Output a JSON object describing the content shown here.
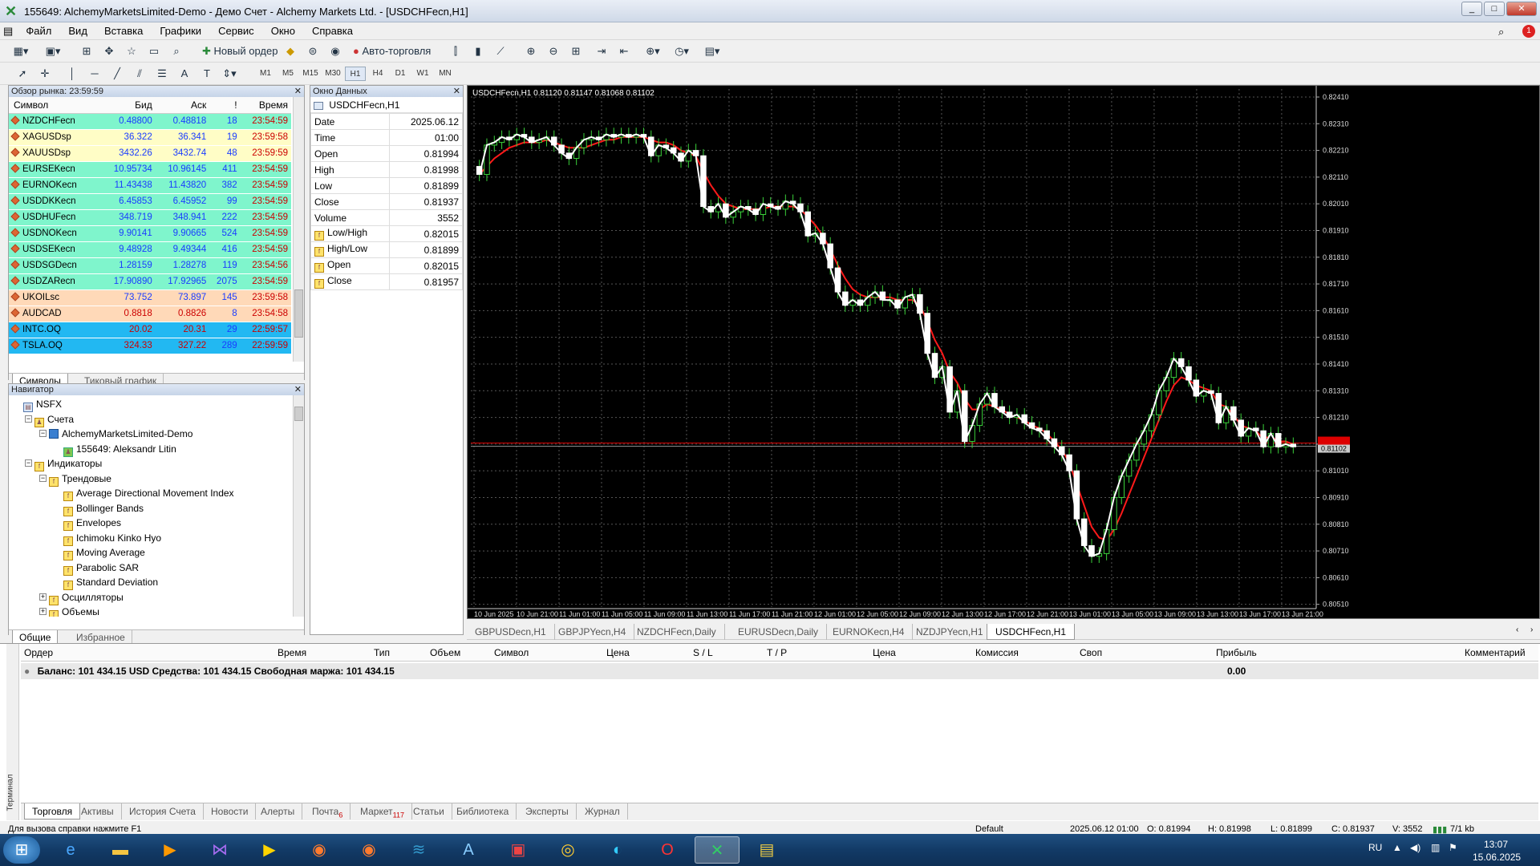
{
  "window": {
    "title": "155649: AlchemyMarketsLimited-Demo - Демо Счет - Alchemy Markets Ltd. - [USDCHFecn,H1]"
  },
  "menu": [
    "Файл",
    "Вид",
    "Вставка",
    "Графики",
    "Сервис",
    "Окно",
    "Справка"
  ],
  "toolbar": {
    "new_order": "Новый ордер",
    "auto_trading": "Авто-торговля"
  },
  "timeframes": [
    "M1",
    "M5",
    "M15",
    "M30",
    "H1",
    "H4",
    "D1",
    "W1",
    "MN"
  ],
  "market_watch": {
    "title": "Обзор рынка: 23:59:59",
    "headers": [
      "Символ",
      "Бид",
      "Аск",
      "!",
      "Время"
    ],
    "rows": [
      {
        "symbol": "NZDCHFecn",
        "bid": "0.48800",
        "ask": "0.48818",
        "spread": "18",
        "time": "23:54:59",
        "bg": "#7ff5cc"
      },
      {
        "symbol": "XAGUSDsp",
        "bid": "36.322",
        "ask": "36.341",
        "spread": "19",
        "time": "23:59:58",
        "bg": "#fffdc6"
      },
      {
        "symbol": "XAUUSDsp",
        "bid": "3432.26",
        "ask": "3432.74",
        "spread": "48",
        "time": "23:59:59",
        "bg": "#fffdc6"
      },
      {
        "symbol": "EURSEKecn",
        "bid": "10.95734",
        "ask": "10.96145",
        "spread": "411",
        "time": "23:54:59",
        "bg": "#7ff5cc"
      },
      {
        "symbol": "EURNOKecn",
        "bid": "11.43438",
        "ask": "11.43820",
        "spread": "382",
        "time": "23:54:59",
        "bg": "#7ff5cc"
      },
      {
        "symbol": "USDDKKecn",
        "bid": "6.45853",
        "ask": "6.45952",
        "spread": "99",
        "time": "23:54:59",
        "bg": "#7ff5cc"
      },
      {
        "symbol": "USDHUFecn",
        "bid": "348.719",
        "ask": "348.941",
        "spread": "222",
        "time": "23:54:59",
        "bg": "#7ff5cc"
      },
      {
        "symbol": "USDNOKecn",
        "bid": "9.90141",
        "ask": "9.90665",
        "spread": "524",
        "time": "23:54:59",
        "bg": "#7ff5cc"
      },
      {
        "symbol": "USDSEKecn",
        "bid": "9.48928",
        "ask": "9.49344",
        "spread": "416",
        "time": "23:54:59",
        "bg": "#7ff5cc"
      },
      {
        "symbol": "USDSGDecn",
        "bid": "1.28159",
        "ask": "1.28278",
        "spread": "119",
        "time": "23:54:56",
        "bg": "#7ff5cc"
      },
      {
        "symbol": "USDZARecn",
        "bid": "17.90890",
        "ask": "17.92965",
        "spread": "2075",
        "time": "23:54:59",
        "bg": "#7ff5cc"
      },
      {
        "symbol": "UKOILsc",
        "bid": "73.752",
        "ask": "73.897",
        "spread": "145",
        "time": "23:59:58",
        "bg": "#ffd9b8"
      },
      {
        "symbol": "AUDCAD",
        "bid": "0.8818",
        "ask": "0.8826",
        "spread": "8",
        "time": "23:54:58",
        "bg": "#ffd9b8"
      },
      {
        "symbol": "INTC.OQ",
        "bid": "20.02",
        "ask": "20.31",
        "spread": "29",
        "time": "22:59:57",
        "bg": "#22b8f2"
      },
      {
        "symbol": "TSLA.OQ",
        "bid": "324.33",
        "ask": "327.22",
        "spread": "289",
        "time": "22:59:59",
        "bg": "#22b8f2"
      }
    ],
    "tabs": [
      "Символы",
      "Тиковый график"
    ]
  },
  "data_window": {
    "title": "Окно Данных",
    "symbol": "USDCHFecn,H1",
    "rows": [
      {
        "k": "Date",
        "v": "2025.06.12"
      },
      {
        "k": "Time",
        "v": "01:00"
      },
      {
        "k": "Open",
        "v": "0.81994"
      },
      {
        "k": "High",
        "v": "0.81998"
      },
      {
        "k": "Low",
        "v": "0.81899"
      },
      {
        "k": "Close",
        "v": "0.81937"
      },
      {
        "k": "Volume",
        "v": "3552"
      },
      {
        "k": "Low/High",
        "v": "0.82015"
      },
      {
        "k": "High/Low",
        "v": "0.81899"
      },
      {
        "k": "Open",
        "v": "0.82015"
      },
      {
        "k": "Close",
        "v": "0.81957"
      }
    ]
  },
  "navigator": {
    "title": "Навигатор",
    "items": [
      {
        "label": "NSFX",
        "level": 0
      },
      {
        "label": "Счета",
        "level": 1
      },
      {
        "label": "AlchemyMarketsLimited-Demo",
        "level": 2
      },
      {
        "label": "155649: Aleksandr Litin",
        "level": 3
      },
      {
        "label": "Индикаторы",
        "level": 1
      },
      {
        "label": "Трендовые",
        "level": 2
      },
      {
        "label": "Average Directional Movement Index",
        "level": 3
      },
      {
        "label": "Bollinger Bands",
        "level": 3
      },
      {
        "label": "Envelopes",
        "level": 3
      },
      {
        "label": "Ichimoku Kinko Hyo",
        "level": 3
      },
      {
        "label": "Moving Average",
        "level": 3
      },
      {
        "label": "Parabolic SAR",
        "level": 3
      },
      {
        "label": "Standard Deviation",
        "level": 3
      },
      {
        "label": "Осцилляторы",
        "level": 2
      },
      {
        "label": "Объемы",
        "level": 2
      }
    ],
    "tabs": [
      "Общие",
      "Избранное"
    ]
  },
  "chart": {
    "header": "USDCHFecn,H1  0.81120 0.81147 0.81068 0.81102",
    "current_price": "0.81102",
    "tabs": [
      "GBPUSDecn,H1",
      "GBPJPYecn,H4",
      "NZDCHFecn,Daily",
      "EURUSDecn,Daily",
      "EURNOKecn,H4",
      "NZDJPYecn,H1",
      "USDCHFecn,H1"
    ]
  },
  "chart_data": {
    "type": "line",
    "title": "",
    "price_levels": [
      "0.82410",
      "0.82310",
      "0.82210",
      "0.82110",
      "0.82010",
      "0.81910",
      "0.81810",
      "0.81710",
      "0.81610",
      "0.81510",
      "0.81410",
      "0.81310",
      "0.81210",
      "0.81110",
      "0.81010",
      "0.80910",
      "0.80810",
      "0.80710",
      "0.80610",
      "0.80510"
    ],
    "ylim": [
      0.805,
      0.8244
    ],
    "time_labels": [
      "10 Jun 2025",
      "10 Jun 21:00",
      "11 Jun 01:00",
      "11 Jun 05:00",
      "11 Jun 09:00",
      "11 Jun 13:00",
      "11 Jun 17:00",
      "11 Jun 21:00",
      "12 Jun 01:00",
      "12 Jun 05:00",
      "12 Jun 09:00",
      "12 Jun 13:00",
      "12 Jun 17:00",
      "12 Jun 21:00",
      "13 Jun 01:00",
      "13 Jun 05:00",
      "13 Jun 09:00",
      "13 Jun 13:00",
      "13 Jun 17:00",
      "13 Jun 21:00"
    ],
    "close": [
      0.8212,
      0.8223,
      0.8224,
      0.8226,
      0.8225,
      0.8227,
      0.8226,
      0.8224,
      0.8225,
      0.8226,
      0.8223,
      0.822,
      0.8218,
      0.8222,
      0.8225,
      0.8226,
      0.8225,
      0.8227,
      0.8226,
      0.8227,
      0.8226,
      0.8227,
      0.8226,
      0.8219,
      0.8223,
      0.8222,
      0.822,
      0.8217,
      0.8221,
      0.8219,
      0.82,
      0.8198,
      0.8201,
      0.8196,
      0.8198,
      0.82,
      0.8199,
      0.8197,
      0.8201,
      0.82,
      0.8199,
      0.8202,
      0.8201,
      0.8198,
      0.8189,
      0.819,
      0.8186,
      0.8177,
      0.8168,
      0.8163,
      0.8165,
      0.8163,
      0.8166,
      0.8168,
      0.8165,
      0.8165,
      0.8162,
      0.8166,
      0.8167,
      0.816,
      0.8145,
      0.8136,
      0.814,
      0.8123,
      0.8131,
      0.8112,
      0.8118,
      0.8126,
      0.813,
      0.8125,
      0.8123,
      0.8121,
      0.8122,
      0.8119,
      0.8117,
      0.8116,
      0.8113,
      0.811,
      0.8107,
      0.8101,
      0.8083,
      0.8073,
      0.8069,
      0.807,
      0.8079,
      0.8091,
      0.8099,
      0.8105,
      0.8111,
      0.8116,
      0.8122,
      0.8131,
      0.8136,
      0.8143,
      0.814,
      0.8135,
      0.8129,
      0.8131,
      0.813,
      0.8119,
      0.8125,
      0.812,
      0.8114,
      0.8117,
      0.8116,
      0.811,
      0.8115,
      0.811,
      0.8111,
      0.811
    ],
    "ma": [
      0.8212,
      0.8215,
      0.8218,
      0.822,
      0.8222,
      0.8223,
      0.8224,
      0.8224,
      0.8224,
      0.8225,
      0.8224,
      0.8223,
      0.8222,
      0.8222,
      0.8222,
      0.8223,
      0.8224,
      0.8225,
      0.8225,
      0.8226,
      0.8226,
      0.8226,
      0.8226,
      0.8225,
      0.8224,
      0.8224,
      0.8223,
      0.8221,
      0.822,
      0.8219,
      0.8213,
      0.8208,
      0.8204,
      0.8201,
      0.82,
      0.8199,
      0.8199,
      0.8199,
      0.8199,
      0.82,
      0.82,
      0.82,
      0.82,
      0.8199,
      0.8196,
      0.8193,
      0.8189,
      0.8184,
      0.8178,
      0.8173,
      0.8169,
      0.8167,
      0.8166,
      0.8166,
      0.8166,
      0.8166,
      0.8165,
      0.8165,
      0.8165,
      0.8163,
      0.8157,
      0.815,
      0.8145,
      0.8138,
      0.8134,
      0.8128,
      0.8124,
      0.8124,
      0.8126,
      0.8125,
      0.8124,
      0.8122,
      0.8121,
      0.812,
      0.8118,
      0.8117,
      0.8115,
      0.8112,
      0.8109,
      0.8104,
      0.8096,
      0.8088,
      0.808,
      0.8076,
      0.8075,
      0.8079,
      0.8085,
      0.8092,
      0.8099,
      0.8106,
      0.8113,
      0.812,
      0.8127,
      0.8133,
      0.8136,
      0.8135,
      0.8133,
      0.8132,
      0.8131,
      0.8126,
      0.8125,
      0.8122,
      0.8118,
      0.8117,
      0.8116,
      0.8113,
      0.8114,
      0.8112,
      0.8112,
      0.8111
    ]
  },
  "terminal": {
    "headers": [
      "Ордер",
      "Время",
      "Тип",
      "Объем",
      "Символ",
      "Цена",
      "S / L",
      "T / P",
      "Цена",
      "Комиссия",
      "Своп",
      "Прибыль",
      "Комментарий"
    ],
    "balance_line": "Баланс: 101 434.15 USD  Средства: 101 434.15  Свободная маржа: 101 434.15",
    "profit": "0.00",
    "side_label": "Терминал",
    "tabs": [
      {
        "label": "Торговля"
      },
      {
        "label": "Активы"
      },
      {
        "label": "История Счета"
      },
      {
        "label": "Новости"
      },
      {
        "label": "Алерты"
      },
      {
        "label": "Почта",
        "badge": "6"
      },
      {
        "label": "Маркет",
        "badge": "117"
      },
      {
        "label": "Статьи"
      },
      {
        "label": "Библиотека"
      },
      {
        "label": "Эксперты"
      },
      {
        "label": "Журнал"
      }
    ]
  },
  "status": {
    "help": "Для вызова справки нажмите F1",
    "profile": "Default",
    "dt": "2025.06.12 01:00",
    "o": "O: 0.81994",
    "h": "H: 0.81998",
    "l": "L: 0.81899",
    "c": "C: 0.81937",
    "v": "V: 3552",
    "conn": "7/1 kb"
  },
  "taskbar": {
    "lang": "RU",
    "time": "13:07",
    "date": "15.06.2025"
  }
}
